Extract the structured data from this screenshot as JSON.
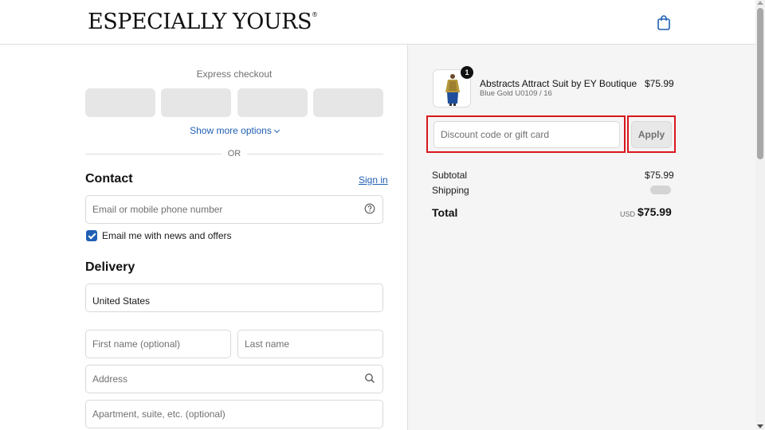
{
  "header": {
    "brand": "ESPECIALLY YOURS",
    "brand_mark": "®",
    "cart_icon": "shopping-bag-icon"
  },
  "express": {
    "title": "Express checkout",
    "show_more": "Show more options",
    "or": "OR"
  },
  "contact": {
    "title": "Contact",
    "sign_in": "Sign in",
    "email_placeholder": "Email or mobile phone number",
    "help_icon": "question-circle-icon",
    "newsletter_label": "Email me with news and offers",
    "newsletter_checked": true
  },
  "delivery": {
    "title": "Delivery",
    "country": "United States",
    "first_name_placeholder": "First name (optional)",
    "last_name_placeholder": "Last name",
    "address_placeholder": "Address",
    "address_icon": "search-icon",
    "apartment_placeholder": "Apartment, suite, etc. (optional)"
  },
  "order": {
    "item": {
      "quantity": "1",
      "name": "Abstracts Attract Suit by EY Boutique",
      "variant": "Blue Gold U0109 / 16",
      "price": "$75.99"
    },
    "discount_placeholder": "Discount code or gift card",
    "apply_label": "Apply",
    "subtotal_label": "Subtotal",
    "subtotal_value": "$75.99",
    "shipping_label": "Shipping",
    "total_label": "Total",
    "total_currency": "USD",
    "total_value": "$75.99"
  },
  "colors": {
    "accent": "#1f5fb3",
    "highlight": "#d8171d",
    "summary_bg": "#f5f5f5"
  }
}
